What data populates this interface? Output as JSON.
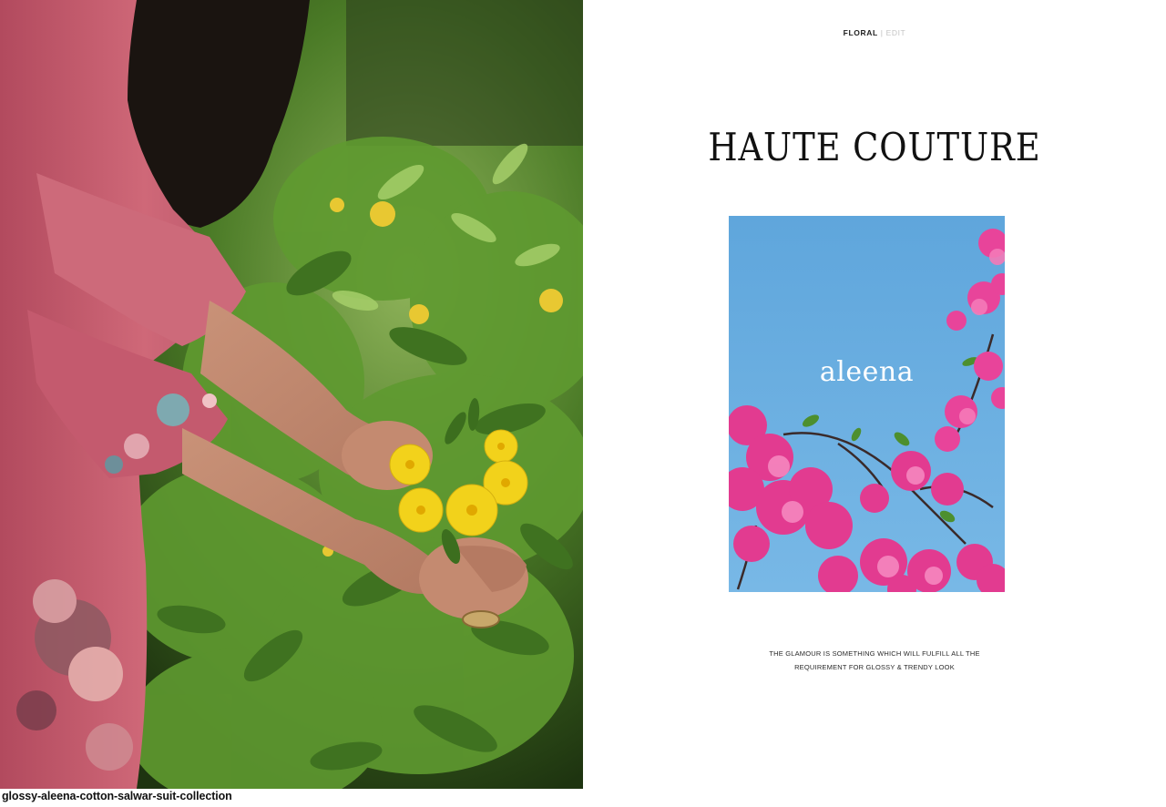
{
  "header": {
    "section_primary": "FLORAL",
    "section_divider": "|",
    "section_secondary": "EDIT"
  },
  "headline": "HAUTE COUTURE",
  "brand_card": {
    "logo_text": "aleena"
  },
  "tagline": {
    "line1": "THE GLAMOUR IS SOMETHING WHICH WILL FULFILL ALL THE",
    "line2": "REQUIREMENT FOR GLOSSY & TRENDY LOOK"
  },
  "caption": "glossy-aleena-cotton-salwar-suit-collection",
  "colors": {
    "sky_blue": "#6aaee0",
    "bougainvillea_pink": "#e83a94",
    "dress_rose": "#c45a6e",
    "flower_yellow": "#f2d21b",
    "leaf_green": "#4f8a2a"
  }
}
